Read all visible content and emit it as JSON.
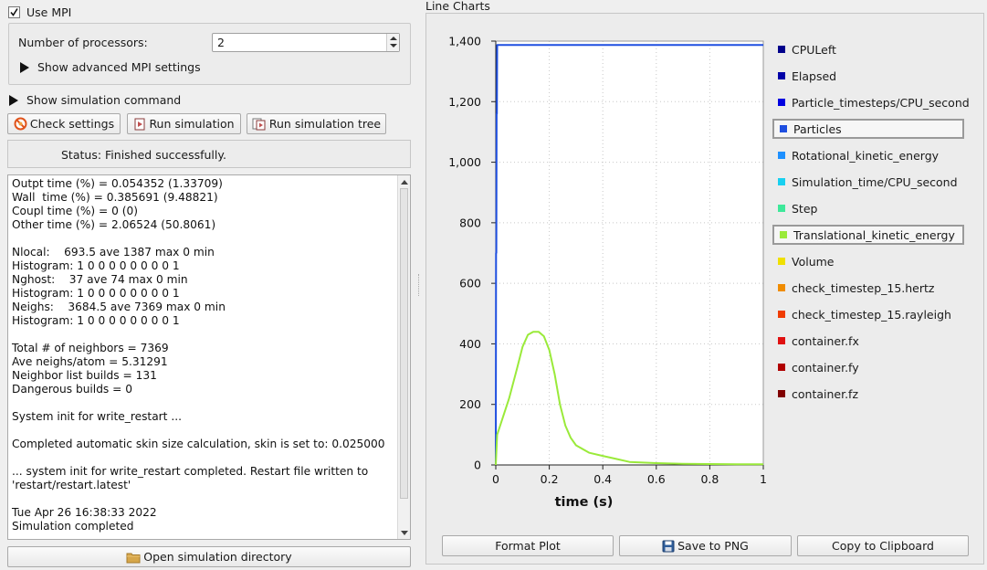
{
  "mpi": {
    "use_mpi_label": "Use MPI",
    "use_mpi_checked": true,
    "processors_label": "Number of processors:",
    "processors_value": "2",
    "advanced_label": "Show advanced MPI settings"
  },
  "sim_command_label": "Show simulation command",
  "buttons": {
    "check_settings": "Check settings",
    "run_simulation": "Run simulation",
    "run_simulation_tree": "Run simulation tree",
    "open_directory": "Open simulation directory",
    "format_plot": "Format Plot",
    "save_png": "Save to PNG",
    "copy_clipboard": "Copy to Clipboard"
  },
  "status": "Status: Finished successfully.",
  "log_lines": [
    "Outpt time (%) = 0.054352 (1.33709)",
    "Wall  time (%) = 0.385691 (9.48821)",
    "Coupl time (%) = 0 (0)",
    "Other time (%) = 2.06524 (50.8061)",
    "",
    "Nlocal:    693.5 ave 1387 max 0 min",
    "Histogram: 1 0 0 0 0 0 0 0 0 1",
    "Nghost:    37 ave 74 max 0 min",
    "Histogram: 1 0 0 0 0 0 0 0 0 1",
    "Neighs:    3684.5 ave 7369 max 0 min",
    "Histogram: 1 0 0 0 0 0 0 0 0 1",
    "",
    "Total # of neighbors = 7369",
    "Ave neighs/atom = 5.31291",
    "Neighbor list builds = 131",
    "Dangerous builds = 0",
    "",
    "System init for write_restart ...",
    "",
    "Completed automatic skin size calculation, skin is set to: 0.025000",
    "",
    "... system init for write_restart completed. Restart file written to",
    "'restart/restart.latest'",
    "",
    "Tue Apr 26 16:38:33 2022",
    "Simulation completed"
  ],
  "chart_panel_title": "Line Charts",
  "chart_data": {
    "type": "line",
    "title": "",
    "xlabel": "time (s)",
    "ylabel": "",
    "xlim": [
      0,
      1
    ],
    "ylim": [
      0,
      1400
    ],
    "x_ticks": [
      "0",
      "0.2",
      "0.4",
      "0.6",
      "0.8",
      "1"
    ],
    "y_ticks": [
      "0",
      "200",
      "400",
      "600",
      "800",
      "1,000",
      "1,200",
      "1,400"
    ],
    "grid": true,
    "legend_position": "right",
    "legend": [
      {
        "name": "CPULeft",
        "color": "#00008b",
        "selected": false
      },
      {
        "name": "Elapsed",
        "color": "#0000a8",
        "selected": false
      },
      {
        "name": "Particle_timesteps/CPU_second",
        "color": "#0000e0",
        "selected": false
      },
      {
        "name": "Particles",
        "color": "#1f4fe0",
        "selected": true
      },
      {
        "name": "Rotational_kinetic_energy",
        "color": "#1e90ff",
        "selected": false
      },
      {
        "name": "Simulation_time/CPU_second",
        "color": "#18d0f0",
        "selected": false
      },
      {
        "name": "Step",
        "color": "#3ee89a",
        "selected": false
      },
      {
        "name": "Translational_kinetic_energy",
        "color": "#9aea3a",
        "selected": true
      },
      {
        "name": "Volume",
        "color": "#f0e000",
        "selected": false
      },
      {
        "name": "check_timestep_15.hertz",
        "color": "#f08c00",
        "selected": false
      },
      {
        "name": "check_timestep_15.rayleigh",
        "color": "#f03c00",
        "selected": false
      },
      {
        "name": "container.fx",
        "color": "#e01010",
        "selected": false
      },
      {
        "name": "container.fy",
        "color": "#b00000",
        "selected": false
      },
      {
        "name": "container.fz",
        "color": "#800000",
        "selected": false
      }
    ],
    "series": [
      {
        "name": "Particles",
        "color": "#1f4fe0",
        "x": [
          0,
          0.0005,
          0.001,
          0.002,
          0.003,
          0.004,
          0.005,
          0.007,
          0.008,
          1.0
        ],
        "y": [
          0,
          230,
          700,
          700,
          1160,
          1160,
          1387,
          1387,
          1387,
          1387
        ]
      },
      {
        "name": "Translational_kinetic_energy",
        "color": "#9aea3a",
        "x": [
          0,
          0.005,
          0.02,
          0.05,
          0.08,
          0.1,
          0.12,
          0.14,
          0.16,
          0.18,
          0.2,
          0.22,
          0.24,
          0.26,
          0.28,
          0.3,
          0.35,
          0.4,
          0.45,
          0.5,
          0.6,
          0.7,
          0.8,
          0.9,
          1.0
        ],
        "y": [
          0,
          100,
          140,
          220,
          320,
          390,
          430,
          440,
          440,
          425,
          380,
          300,
          200,
          130,
          90,
          65,
          40,
          30,
          20,
          10,
          6,
          4,
          3,
          2,
          2
        ]
      }
    ]
  },
  "icons": {
    "check": "check-icon",
    "no_entry": "no-entry-icon",
    "run": "run-icon",
    "run_tree": "run-tree-icon",
    "folder": "folder-icon",
    "save": "floppy-icon"
  }
}
